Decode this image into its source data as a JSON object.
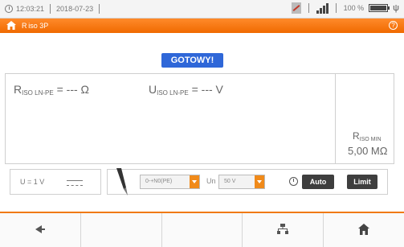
{
  "statusbar": {
    "time": "12:03:21",
    "date": "2018-07-23",
    "battery_percent": "100 %"
  },
  "titlebar": {
    "title": "R iso 3P"
  },
  "badge": "GOTOWY!",
  "results": {
    "riso_prefix": "R",
    "riso_sub": "ISO LN-PE",
    "riso_value": "= --- Ω",
    "uiso_prefix": "U",
    "uiso_sub": "ISO LN-PE",
    "uiso_value": "= --- V",
    "limit_prefix": "R",
    "limit_sub": "ISO MIN",
    "limit_value": "5,00 MΩ"
  },
  "voltage_box": {
    "label": "U = 1 V"
  },
  "controls": {
    "mode_select": "0-+N0(PE)",
    "un_label": "Un",
    "un_select": "50 V",
    "auto_button": "Auto",
    "limit_button": "Limit"
  },
  "colors": {
    "accent": "#f07a10",
    "badge": "#2f67d8",
    "button": "#3e3e3e"
  }
}
